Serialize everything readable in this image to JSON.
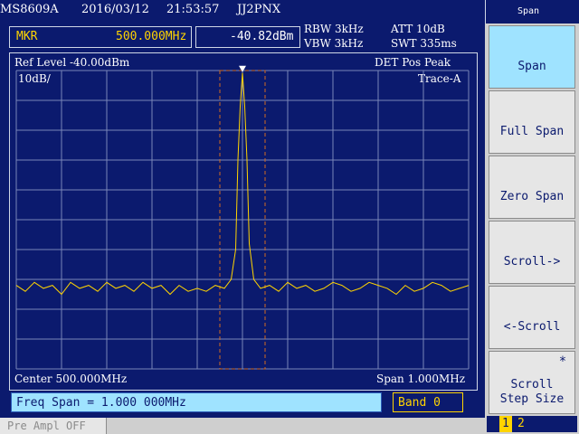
{
  "header": {
    "model": "MS8609A",
    "date": "2016/03/12",
    "time": "21:53:57",
    "call": "JJ2PNX"
  },
  "marker": {
    "label": "MKR",
    "freq": "500.000MHz",
    "level": "-40.82dBm"
  },
  "settings": {
    "rbw": "RBW 3kHz",
    "vbw": "VBW 3kHz",
    "att": "ATT 10dB",
    "swt": "SWT 335ms"
  },
  "graph": {
    "ref_level": "Ref Level -40.00dBm",
    "det": "DET  Pos Peak",
    "scale": "10dB/",
    "trace": "Trace-A",
    "center": "Center 500.000MHz",
    "span": "Span 1.000MHz"
  },
  "entry": {
    "freq_span": "Freq Span = 1.000 000MHz",
    "band": "Band 0"
  },
  "footer": {
    "pre_ampl": "Pre Ampl OFF"
  },
  "menu": {
    "title": "Span",
    "buttons": [
      {
        "label": "Span"
      },
      {
        "label": "Full Span"
      },
      {
        "label": "Zero Span"
      },
      {
        "label": "Scroll->"
      },
      {
        "label": "<-Scroll"
      },
      {
        "label_line1": "Scroll",
        "label_line2": "Step Size"
      }
    ],
    "star": "*",
    "pages": [
      "1",
      "2"
    ]
  },
  "colors": {
    "background": "#0b1a6e",
    "grid": "#7a86b8",
    "trace": "#ffd400",
    "highlight": "#9fe3ff"
  },
  "chart_data": {
    "type": "line",
    "title": "",
    "xlabel": "",
    "ylabel": "",
    "x_center_mhz": 500.0,
    "x_span_mhz": 1.0,
    "x_range_mhz": [
      499.5,
      500.5
    ],
    "y_range_dbm": [
      -140,
      -40
    ],
    "series": [
      {
        "values": [
          {
            "x": 499.5,
            "y": -112
          },
          {
            "x": 499.52,
            "y": -114
          },
          {
            "x": 499.54,
            "y": -111
          },
          {
            "x": 499.56,
            "y": -113
          },
          {
            "x": 499.58,
            "y": -112
          },
          {
            "x": 499.6,
            "y": -115
          },
          {
            "x": 499.62,
            "y": -111
          },
          {
            "x": 499.64,
            "y": -113
          },
          {
            "x": 499.66,
            "y": -112
          },
          {
            "x": 499.68,
            "y": -114
          },
          {
            "x": 499.7,
            "y": -111
          },
          {
            "x": 499.72,
            "y": -113
          },
          {
            "x": 499.74,
            "y": -112
          },
          {
            "x": 499.76,
            "y": -114
          },
          {
            "x": 499.78,
            "y": -111
          },
          {
            "x": 499.8,
            "y": -113
          },
          {
            "x": 499.82,
            "y": -112
          },
          {
            "x": 499.84,
            "y": -115
          },
          {
            "x": 499.86,
            "y": -112
          },
          {
            "x": 499.88,
            "y": -114
          },
          {
            "x": 499.9,
            "y": -113
          },
          {
            "x": 499.92,
            "y": -114
          },
          {
            "x": 499.94,
            "y": -112
          },
          {
            "x": 499.96,
            "y": -113
          },
          {
            "x": 499.975,
            "y": -110
          },
          {
            "x": 499.985,
            "y": -100
          },
          {
            "x": 499.99,
            "y": -70
          },
          {
            "x": 499.995,
            "y": -52
          },
          {
            "x": 500.0,
            "y": -40.82
          },
          {
            "x": 500.005,
            "y": -52
          },
          {
            "x": 500.01,
            "y": -70
          },
          {
            "x": 500.015,
            "y": -98
          },
          {
            "x": 500.025,
            "y": -110
          },
          {
            "x": 500.04,
            "y": -113
          },
          {
            "x": 500.06,
            "y": -112
          },
          {
            "x": 500.08,
            "y": -114
          },
          {
            "x": 500.1,
            "y": -111
          },
          {
            "x": 500.12,
            "y": -113
          },
          {
            "x": 500.14,
            "y": -112
          },
          {
            "x": 500.16,
            "y": -114
          },
          {
            "x": 500.18,
            "y": -113
          },
          {
            "x": 500.2,
            "y": -111
          },
          {
            "x": 500.22,
            "y": -112
          },
          {
            "x": 500.24,
            "y": -114
          },
          {
            "x": 500.26,
            "y": -113
          },
          {
            "x": 500.28,
            "y": -111
          },
          {
            "x": 500.3,
            "y": -112
          },
          {
            "x": 500.32,
            "y": -113
          },
          {
            "x": 500.34,
            "y": -115
          },
          {
            "x": 500.36,
            "y": -112
          },
          {
            "x": 500.38,
            "y": -114
          },
          {
            "x": 500.4,
            "y": -113
          },
          {
            "x": 500.42,
            "y": -111
          },
          {
            "x": 500.44,
            "y": -112
          },
          {
            "x": 500.46,
            "y": -114
          },
          {
            "x": 500.48,
            "y": -113
          },
          {
            "x": 500.5,
            "y": -112
          }
        ]
      }
    ]
  }
}
